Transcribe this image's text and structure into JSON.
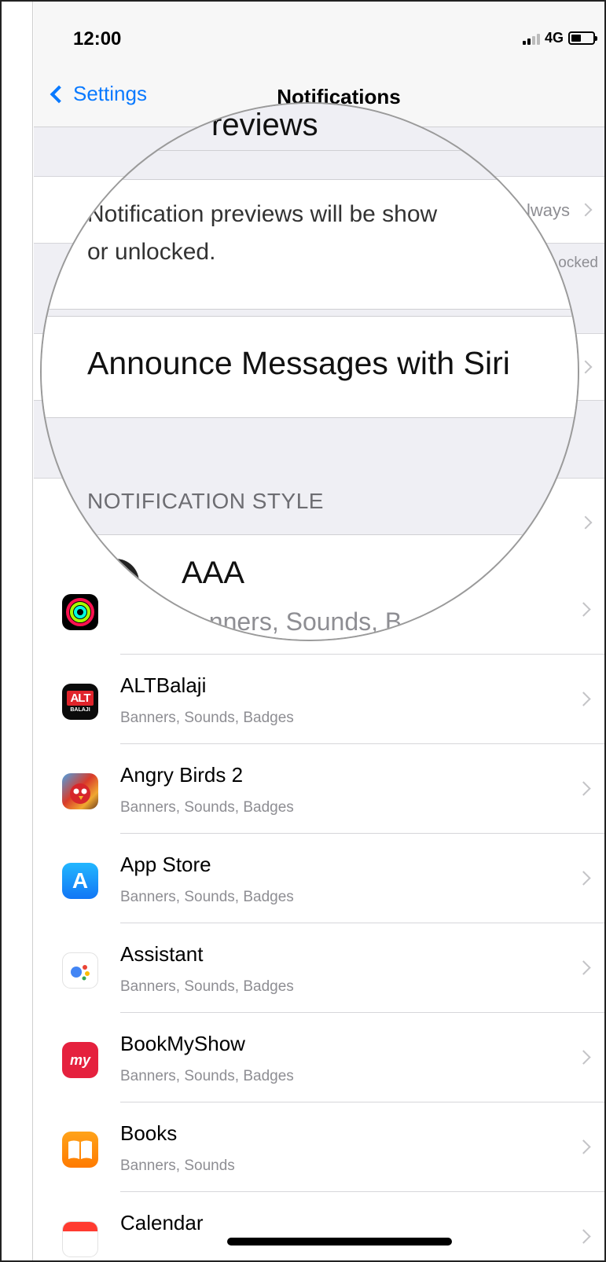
{
  "status_bar": {
    "time": "12:00",
    "network": "4G",
    "battery_level": 0.45
  },
  "nav": {
    "back_label": "Settings",
    "title": "Notifications"
  },
  "background": {
    "show_previews_value": "lways",
    "previews_when_unlocked": "ocked"
  },
  "magnifier": {
    "previews_heading": "reviews",
    "previews_note_line1": "Notification previews will be show",
    "previews_note_line2": "or unlocked.",
    "announce_label": "Announce Messages with Siri",
    "style_header": "NOTIFICATION STYLE",
    "first_app_name": "AAA",
    "first_app_sub_small": "Banners",
    "first_app_sub_large": "nners, Sounds, B"
  },
  "apps": [
    {
      "name": "",
      "subtitle": "",
      "icon": "activity-icon"
    },
    {
      "name": "ALTBalaji",
      "subtitle": "Banners, Sounds, Badges",
      "icon": "altbalaji-icon",
      "icon_text_top": "ALT",
      "icon_text_bottom": "BALAJI"
    },
    {
      "name": "Angry Birds 2",
      "subtitle": "Banners, Sounds, Badges",
      "icon": "angry-birds-icon"
    },
    {
      "name": "App Store",
      "subtitle": "Banners, Sounds, Badges",
      "icon": "app-store-icon",
      "icon_glyph": "A"
    },
    {
      "name": "Assistant",
      "subtitle": "Banners, Sounds, Badges",
      "icon": "assistant-icon"
    },
    {
      "name": "BookMyShow",
      "subtitle": "Banners, Sounds, Badges",
      "icon": "bookmyshow-icon",
      "icon_text": "my"
    },
    {
      "name": "Books",
      "subtitle": "Banners, Sounds",
      "icon": "books-icon"
    },
    {
      "name": "Calendar",
      "subtitle": "",
      "icon": "calendar-icon"
    }
  ],
  "colors": {
    "ios_blue": "#0a7aff",
    "group_bg": "#efeff4",
    "separator": "#d6d6da",
    "secondary_text": "#8e8e93"
  }
}
